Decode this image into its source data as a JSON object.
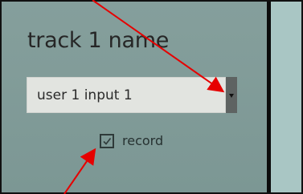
{
  "track": {
    "name": "track 1 name"
  },
  "input_selector": {
    "selected": "user 1 input 1"
  },
  "record": {
    "label": "record",
    "checked": true
  },
  "icons": {
    "dropdown": "dropdown-arrow-icon",
    "checkmark": "checkmark-icon",
    "annotation_arrow": "annotation-arrow"
  },
  "colors": {
    "panel": "#7f9a97",
    "right_panel": "#a9c6c4",
    "select_bg": "#e2e4e0",
    "dropdown_button": "#5e6362",
    "annotation": "#e60000"
  }
}
